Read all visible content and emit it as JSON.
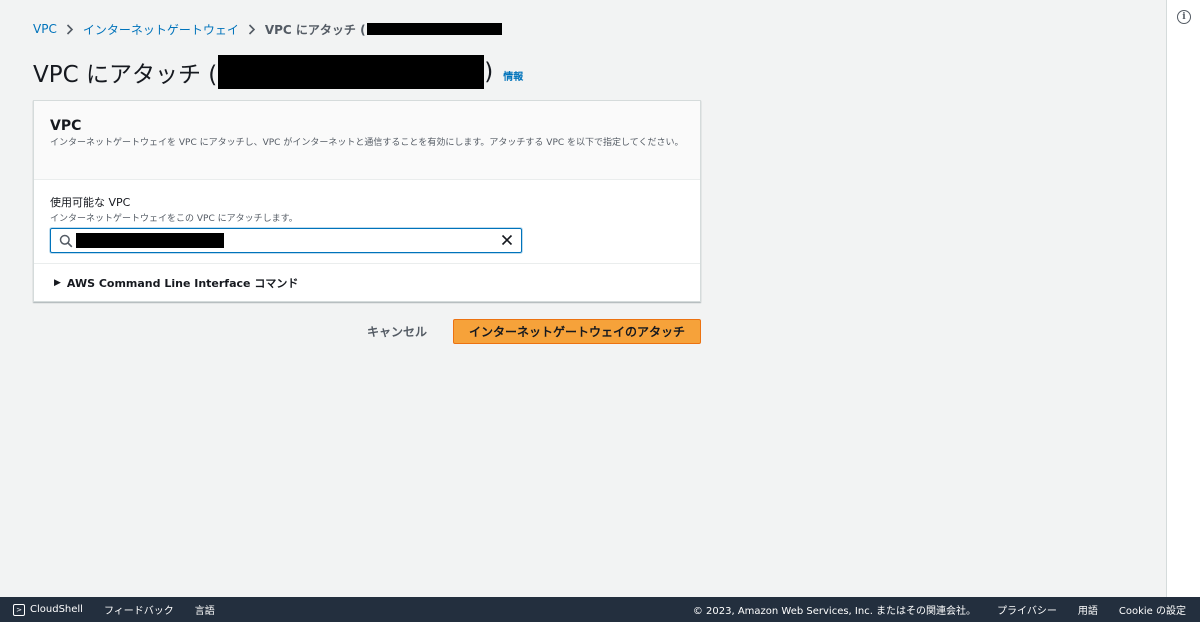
{
  "breadcrumb": {
    "vpc": "VPC",
    "igw": "インターネットゲートウェイ",
    "current": "VPC にアタッチ ("
  },
  "page": {
    "title": "VPC にアタッチ (",
    "title_close": ")",
    "info": "情報"
  },
  "panel": {
    "heading": "VPC",
    "description": "インターネットゲートウェイを VPC にアタッチし、VPC がインターネットと通信することを有効にします。アタッチする VPC を以下で指定してください。",
    "field_label": "使用可能な VPC",
    "field_description": "インターネットゲートウェイをこの VPC にアタッチします。",
    "cli_expander": "AWS Command Line Interface コマンド"
  },
  "actions": {
    "cancel": "キャンセル",
    "attach": "インターネットゲートウェイのアタッチ"
  },
  "footer": {
    "cloudshell": "CloudShell",
    "feedback": "フィードバック",
    "language": "言語",
    "copyright": "© 2023, Amazon Web Services, Inc. またはその関連会社。",
    "privacy": "プライバシー",
    "terms": "用語",
    "cookie": "Cookie の設定"
  },
  "colors": {
    "link": "#0073bb",
    "primary_button": "#f6a23a",
    "footer_bg": "#232f3e"
  }
}
